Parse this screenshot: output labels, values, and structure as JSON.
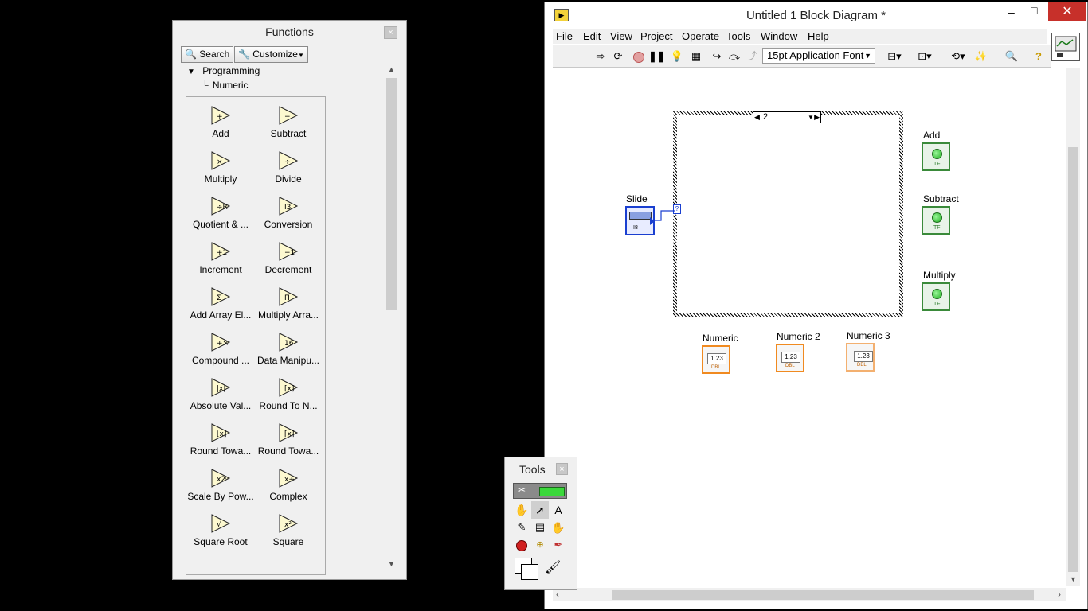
{
  "functions_palette": {
    "title": "Functions",
    "close": "×",
    "search_label": "Search",
    "customize_label": "Customize",
    "tree_root": "Programming",
    "tree_child": "Numeric",
    "items": [
      {
        "label": "Add",
        "icon": "+"
      },
      {
        "label": "Subtract",
        "icon": "−"
      },
      {
        "label": "Multiply",
        "icon": "×"
      },
      {
        "label": "Divide",
        "icon": "÷"
      },
      {
        "label": "Quotient & ...",
        "icon": "÷R IQ"
      },
      {
        "label": "Conversion",
        "icon": "I32 DBL"
      },
      {
        "label": "Increment",
        "icon": "+1"
      },
      {
        "label": "Decrement",
        "icon": "−1"
      },
      {
        "label": "Add Array El...",
        "icon": "Σ"
      },
      {
        "label": "Multiply Arra...",
        "icon": "Π"
      },
      {
        "label": "Compound ...",
        "icon": "+×"
      },
      {
        "label": "Data Manipu...",
        "icon": "16:16"
      },
      {
        "label": "Absolute Val...",
        "icon": "|x|"
      },
      {
        "label": "Round To N...",
        "icon": "[x]"
      },
      {
        "label": "Round Towa...",
        "icon": "⌊x⌋"
      },
      {
        "label": "Round Towa...",
        "icon": "⌈x⌉"
      },
      {
        "label": "Scale By Pow...",
        "icon": "x2ⁿ"
      },
      {
        "label": "Complex",
        "icon": "x+iy"
      },
      {
        "label": "Square Root",
        "icon": "√"
      },
      {
        "label": "Square",
        "icon": "x²"
      }
    ]
  },
  "block_diagram": {
    "window_title": "Untitled 1 Block Diagram *",
    "menu": [
      "File",
      "Edit",
      "View",
      "Project",
      "Operate",
      "Tools",
      "Window",
      "Help"
    ],
    "font_selector": "15pt Application Font",
    "case_selector_value": "2",
    "controls": {
      "slide_label": "Slide",
      "slide_type": "I8",
      "numeric_labels": [
        "Numeric",
        "Numeric 2",
        "Numeric 3"
      ],
      "numeric_value": "1.23",
      "numeric_type": "DBL"
    },
    "indicators": [
      {
        "label": "Add"
      },
      {
        "label": "Subtract"
      },
      {
        "label": "Multiply"
      }
    ],
    "indicator_type": "TF"
  },
  "tools_palette": {
    "title": "Tools",
    "close": "×"
  },
  "colors": {
    "wire_blue": "#1a3fd0",
    "numeric_orange": "#f08a20",
    "boolean_green": "#3a8a3a"
  }
}
